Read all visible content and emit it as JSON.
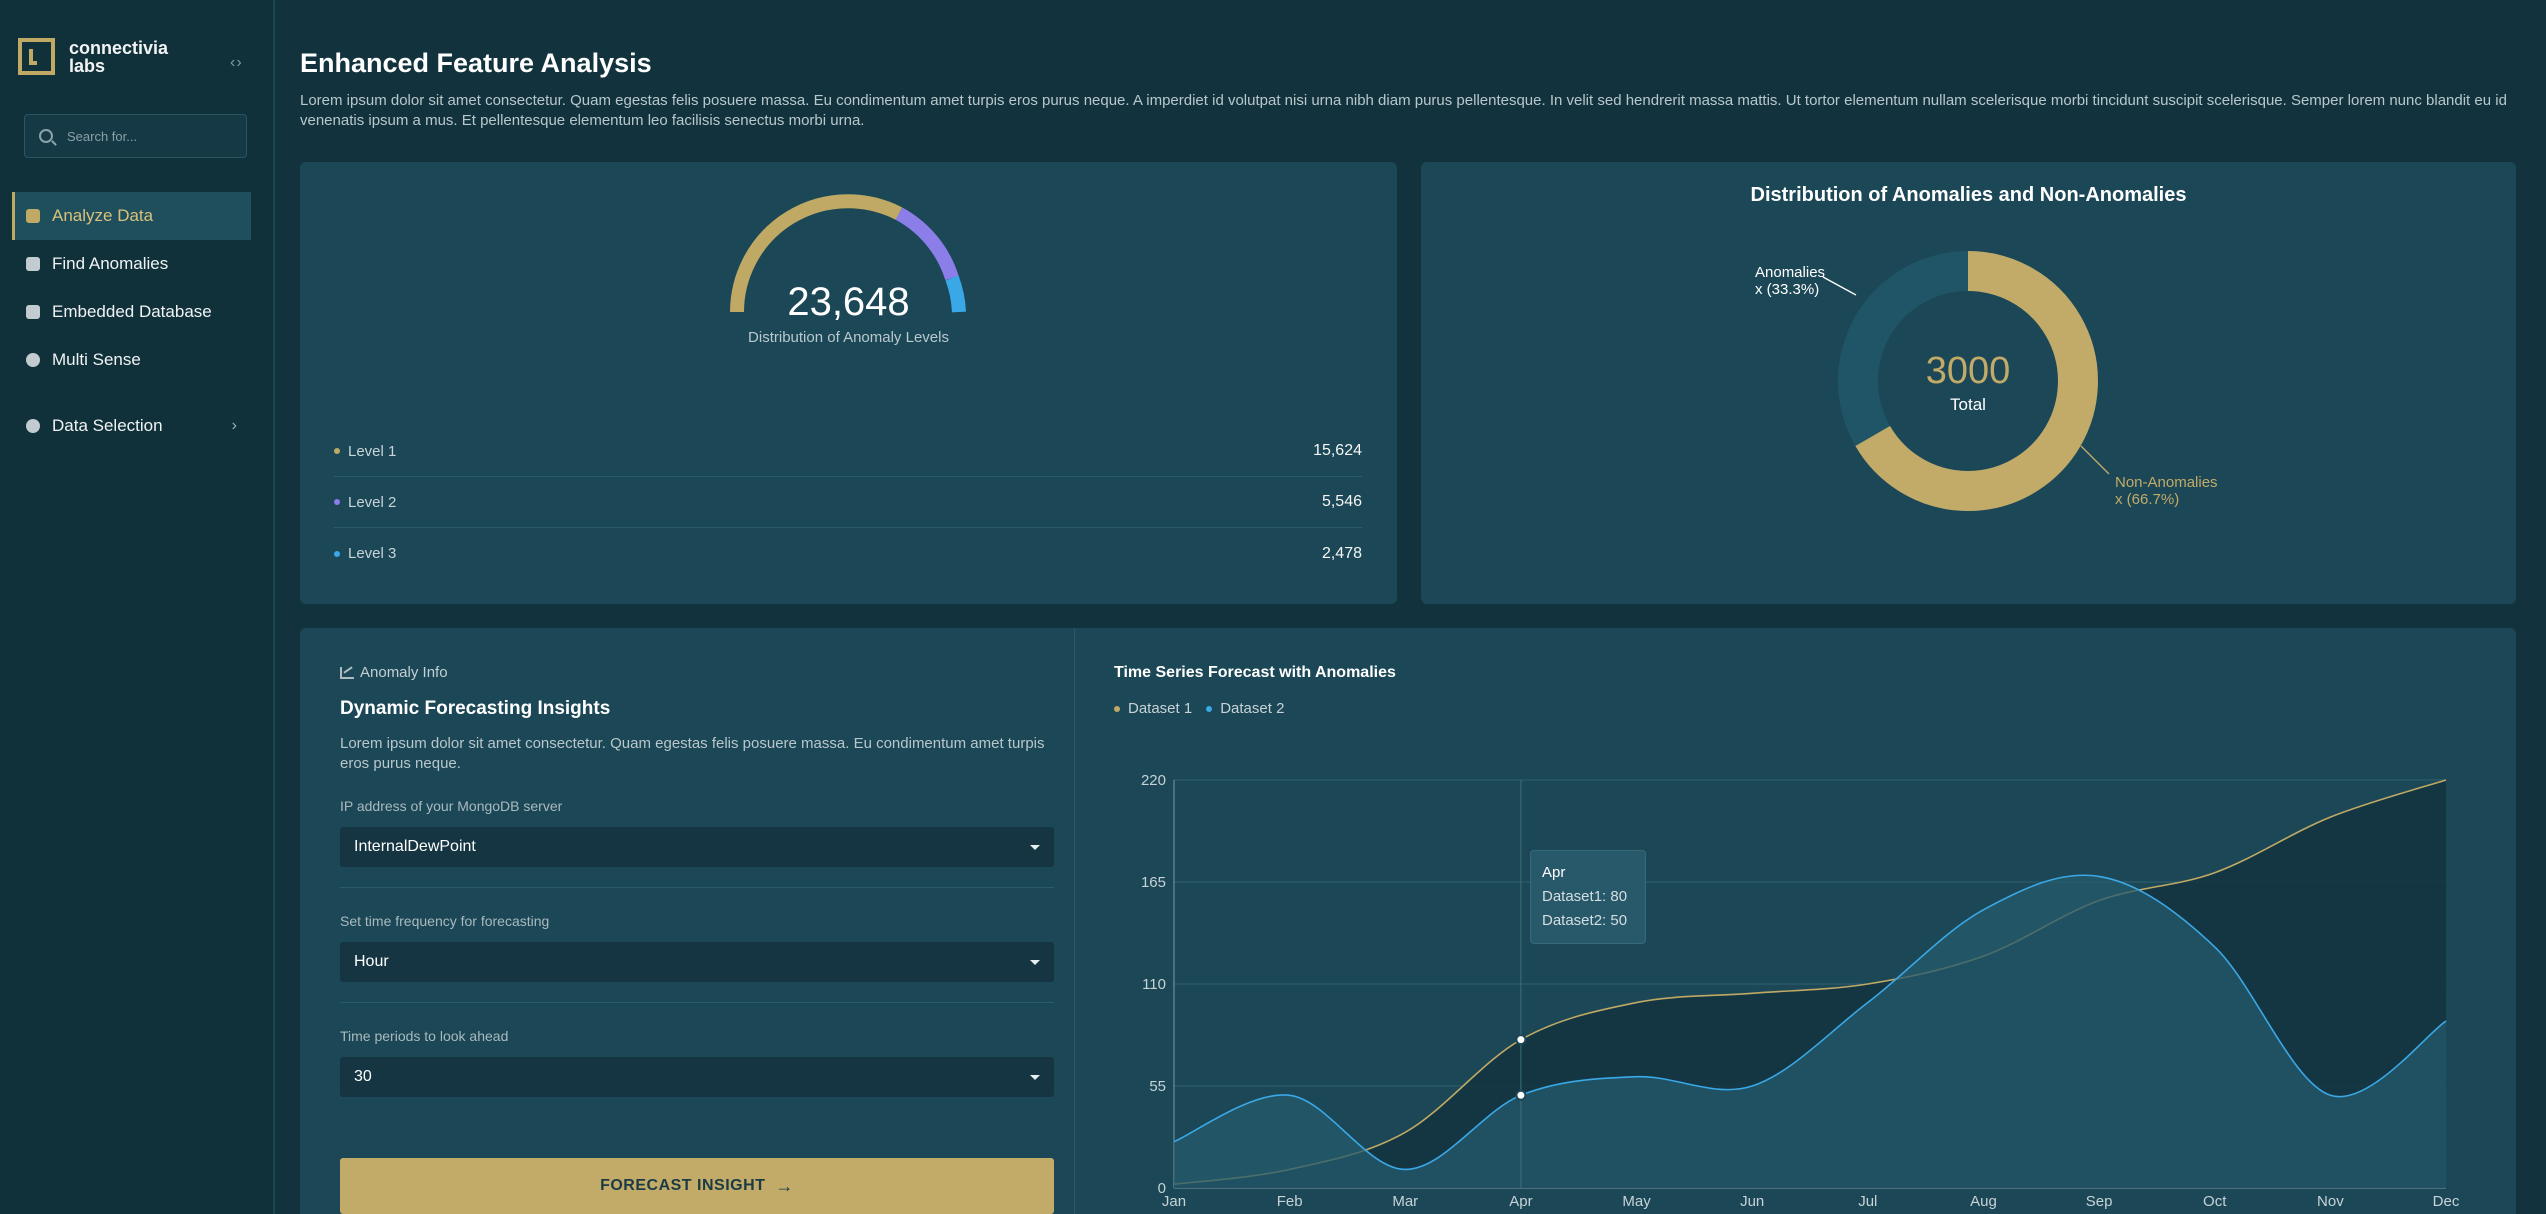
{
  "brand": {
    "line1": "connectivia",
    "line2": "labs"
  },
  "sidebar": {
    "collapse_icon": "‹›",
    "search_placeholder": "Search for...",
    "items": [
      {
        "label": "Analyze Data",
        "icon": "database-icon",
        "active": true
      },
      {
        "label": "Find Anomalies",
        "icon": "anomaly-icon"
      },
      {
        "label": "Embedded Database",
        "icon": "stack-icon"
      },
      {
        "label": "Multi Sense",
        "icon": "sense-icon"
      }
    ],
    "data_selection": {
      "label": "Data Selection",
      "icon": "gear-icon"
    }
  },
  "page": {
    "title": "Enhanced Feature Analysis",
    "description": "Lorem ipsum dolor sit amet consectetur. Quam egestas felis posuere massa. Eu condimentum amet turpis eros purus neque. A imperdiet id volutpat nisi urna nibh diam purus pellentesque. In velit sed hendrerit massa mattis. Ut tortor elementum nullam scelerisque morbi tincidunt suscipit scelerisque. Semper lorem nunc blandit eu id venenatis ipsum a mus. Et pellentesque elementum leo facilisis senectus morbi urna."
  },
  "gauge": {
    "value": "23,648",
    "label": "Distribution of Anomaly Levels",
    "levels": [
      {
        "label": "Level 1",
        "value": "15,624",
        "color": "#bfa964"
      },
      {
        "label": "Level 2",
        "value": "5,546",
        "color": "#8b7ee8"
      },
      {
        "label": "Level 3",
        "value": "2,478",
        "color": "#3aa8e6"
      }
    ]
  },
  "donut": {
    "title": "Distribution of Anomalies and Non-Anomalies",
    "total": "3000",
    "total_label": "Total",
    "anomalies": {
      "line1": "Anomalies",
      "line2": "x (33.3%)",
      "percent": 33.3,
      "color": "#1f5566"
    },
    "non_anomalies": {
      "line1": "Non-Anomalies",
      "line2": "x (66.7%)",
      "percent": 66.7,
      "color": "#c2ab69"
    }
  },
  "forecast": {
    "section_label": "Anomaly Info",
    "title": "Dynamic Forecasting Insights",
    "description": "Lorem ipsum dolor sit amet consectetur. Quam egestas felis posuere massa. Eu condimentum amet turpis eros purus neque.",
    "fields": [
      {
        "label": "IP address of your MongoDB server",
        "value": "InternalDewPoint"
      },
      {
        "label": "Set time frequency for forecasting",
        "value": "Hour"
      },
      {
        "label": "Time periods to look ahead",
        "value": "30"
      }
    ],
    "button": "FORECAST INSIGHT"
  },
  "chart_data": {
    "type": "area",
    "title": "Time Series Forecast with Anomalies",
    "categories": [
      "Jan",
      "Feb",
      "Mar",
      "Apr",
      "May",
      "Jun",
      "Jul",
      "Aug",
      "Sep",
      "Oct",
      "Nov",
      "Dec"
    ],
    "yticks": [
      0,
      55,
      110,
      165,
      220
    ],
    "ylim": [
      0,
      220
    ],
    "series": [
      {
        "name": "Dataset 1",
        "color": "#bfa964",
        "values": [
          2,
          10,
          30,
          80,
          100,
          105,
          110,
          125,
          155,
          170,
          200,
          220
        ]
      },
      {
        "name": "Dataset 2",
        "color": "#3aa8e6",
        "values": [
          25,
          50,
          10,
          50,
          60,
          55,
          100,
          150,
          168,
          130,
          50,
          90
        ]
      }
    ],
    "tooltip": {
      "title": "Apr",
      "line1": "Dataset1: 80",
      "line2": "Dataset2: 50"
    },
    "legend": "top-left"
  }
}
